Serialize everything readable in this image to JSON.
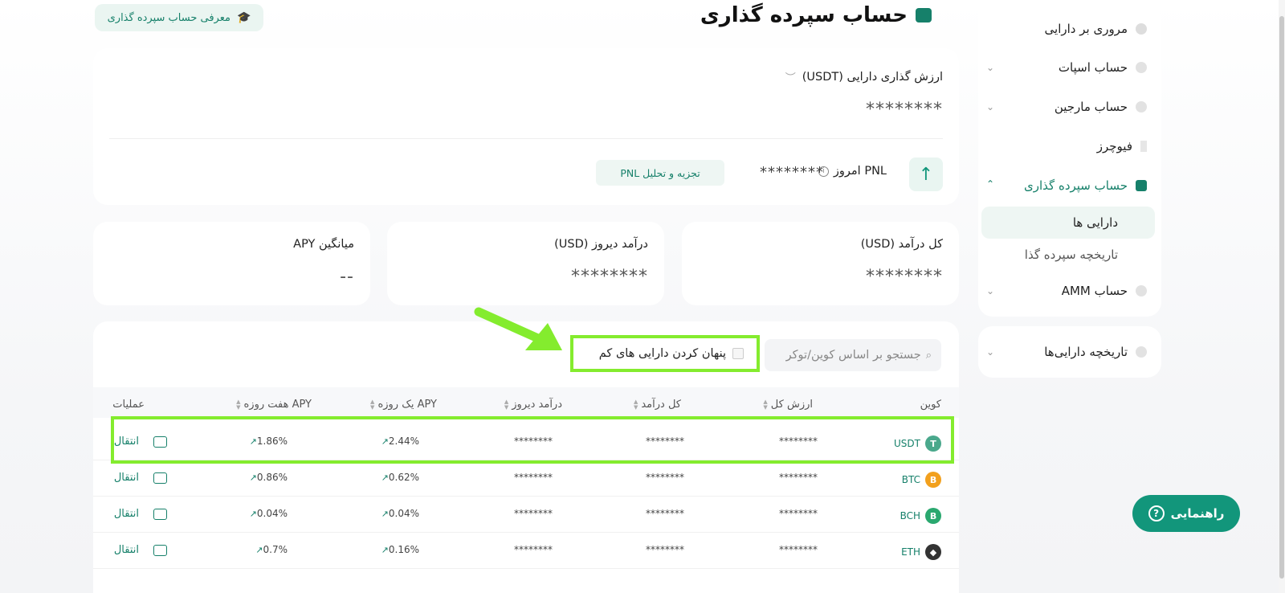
{
  "sidebar": {
    "items": [
      {
        "label": "مروری بر دارایی"
      },
      {
        "label": "حساب اسپات"
      },
      {
        "label": "حساب مارجین"
      },
      {
        "label": "فیوچرز"
      },
      {
        "label": "حساب سپرده گذاری"
      },
      {
        "label": "حساب AMM"
      }
    ],
    "subitems": [
      {
        "label": "دارایی ها"
      },
      {
        "label": "تاریخچه سپرده گذا"
      }
    ],
    "history_label": "تاریخچه دارایی‌ها"
  },
  "header": {
    "title": "حساب سپرده گذاری",
    "intro_button": "معرفی حساب سپرده گذاری"
  },
  "summary": {
    "asset_value_label": "ارزش گذاری دارایی (USDT)",
    "asset_value": "********",
    "pnl_label": "PNL امروز",
    "pnl_value": "********",
    "analyze_button": "تجزیه و تحلیل PNL"
  },
  "stats": [
    {
      "label": "کل درآمد (USD)",
      "value": "********"
    },
    {
      "label": "درآمد دیروز (USD)",
      "value": "********"
    },
    {
      "label": "میانگین APY",
      "value": "--"
    }
  ],
  "filters": {
    "search_placeholder": "جستجو بر اساس کوین/توکر",
    "hide_small_label": "پنهان کردن دارایی های کم"
  },
  "table": {
    "headers": [
      "کوین",
      "ارزش کل",
      "کل درآمد",
      "درآمد دیروز",
      "APY یک روزه",
      "APY هفت روزه",
      "عملیات"
    ],
    "rows": [
      {
        "coin": "USDT",
        "total": "********",
        "income": "********",
        "yesterday": "********",
        "apy1": "2.44%",
        "apy7": "1.86%",
        "action": "انتقال",
        "color": "#4aa88c",
        "glyph": "T"
      },
      {
        "coin": "BTC",
        "total": "********",
        "income": "********",
        "yesterday": "********",
        "apy1": "0.62%",
        "apy7": "0.86%",
        "action": "انتقال",
        "color": "#f2a01d",
        "glyph": "B"
      },
      {
        "coin": "BCH",
        "total": "********",
        "income": "********",
        "yesterday": "********",
        "apy1": "0.04%",
        "apy7": "0.04%",
        "action": "انتقال",
        "color": "#2aa86f",
        "glyph": "B"
      },
      {
        "coin": "ETH",
        "total": "********",
        "income": "********",
        "yesterday": "********",
        "apy1": "0.16%",
        "apy7": "0.7%",
        "action": "انتقال",
        "color": "#333333",
        "glyph": "◆"
      }
    ]
  },
  "help_button": "راهنمایی"
}
